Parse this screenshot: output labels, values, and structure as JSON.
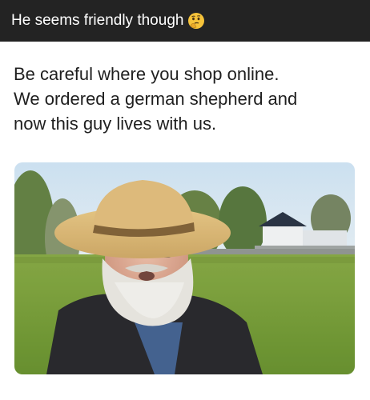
{
  "caption": {
    "text": "He seems friendly though",
    "emoji": "thinking-face-icon"
  },
  "post": {
    "lines": [
      "Be careful where you shop online.",
      "We ordered a german shepherd and",
      "now this guy lives with us."
    ]
  },
  "photo": {
    "description_icon": "photo-of-man-in-straw-hat"
  },
  "colors": {
    "caption_bg": "#232323",
    "caption_text": "#ffffff",
    "body_text": "#1f1f1f",
    "page_bg": "#ffffff"
  }
}
